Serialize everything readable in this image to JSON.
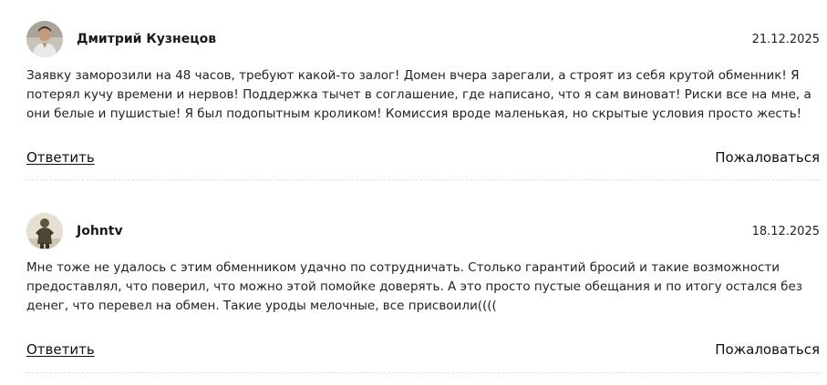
{
  "comments": [
    {
      "author": "Дмитрий Кузнецов",
      "date": "21.12.2025",
      "text": "Заявку заморозили на 48 часов, требуют какой-то залог! Домен вчера зарегали, а строят из себя крутой обменник! Я потерял кучу времени и нервов! Поддержка тычет в соглашение, где написано, что я сам виноват! Риски все на мне, а они белые и пушистые! Я был подопытным кроликом! Комиссия вроде маленькая, но скрытые условия просто жесть!",
      "reply_label": "Ответить",
      "report_label": "Пожаловаться",
      "avatar_icon": "user-photo-icon"
    },
    {
      "author": "Johntv",
      "date": "18.12.2025",
      "text": "Мне тоже не удалось с этим обменником удачно по сотрудничать. Столько гарантий бросий и такие возможности предоставлял, что поверил, что можно этой помойке доверять. А это просто пустые обещания и по итогу остался без денег, что перевел на обмен. Такие уроды мелочные, все присвоили((((",
      "reply_label": "Ответить",
      "report_label": "Пожаловаться",
      "avatar_icon": "user-photo-icon"
    }
  ]
}
